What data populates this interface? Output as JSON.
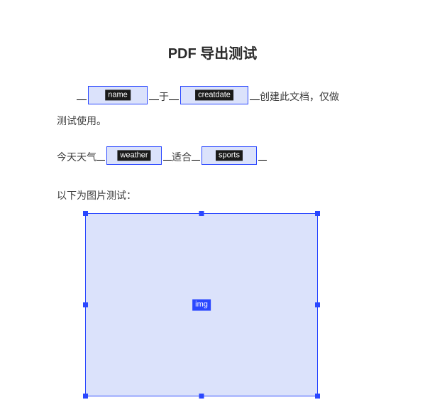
{
  "title": "PDF 导出测试",
  "line1": {
    "field_name_tag": "name",
    "connector": "于",
    "field_date_tag": "creatdate",
    "tail": "创建此文档，仅做"
  },
  "line1b_tail": "测试使用。",
  "line2": {
    "prefix": "今天天气",
    "field_weather_tag": "weather",
    "mid": "适合",
    "field_sports_tag": "sports"
  },
  "image_section_label": "以下为图片测试：",
  "image_placeholder_tag": "img"
}
